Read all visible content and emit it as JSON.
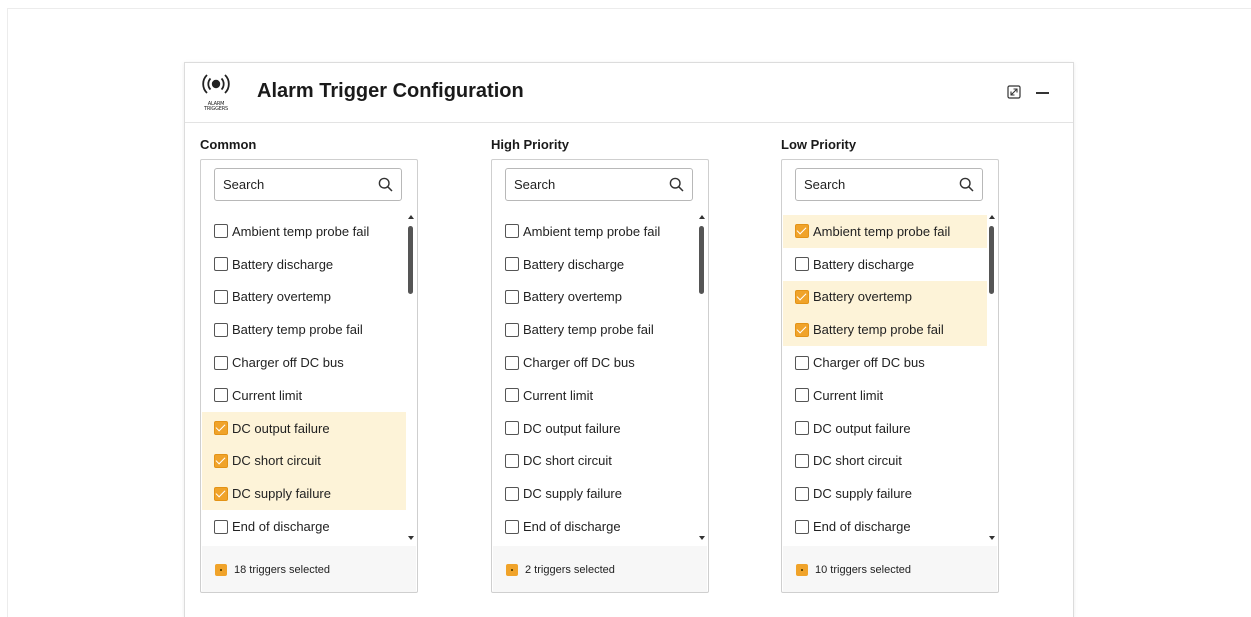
{
  "window": {
    "title": "Alarm Trigger Configuration",
    "logo_text_line1": "ALARM",
    "logo_text_line2": "TRIGGERS"
  },
  "colors": {
    "accent": "#f0a32a",
    "highlight": "#fdf3d8"
  },
  "columns": [
    {
      "heading": "Common",
      "search_placeholder": "Search",
      "items": [
        {
          "label": "Ambient temp probe fail",
          "checked": false
        },
        {
          "label": "Battery discharge",
          "checked": false
        },
        {
          "label": "Battery overtemp",
          "checked": false
        },
        {
          "label": "Battery temp probe fail",
          "checked": false
        },
        {
          "label": "Charger off DC bus",
          "checked": false
        },
        {
          "label": "Current limit",
          "checked": false
        },
        {
          "label": "DC output failure",
          "checked": true
        },
        {
          "label": "DC short circuit",
          "checked": true
        },
        {
          "label": "DC supply failure",
          "checked": true
        },
        {
          "label": "End of discharge",
          "checked": false
        }
      ],
      "footer": "18 triggers selected"
    },
    {
      "heading": "High Priority",
      "search_placeholder": "Search",
      "items": [
        {
          "label": "Ambient temp probe fail",
          "checked": false
        },
        {
          "label": "Battery discharge",
          "checked": false
        },
        {
          "label": "Battery overtemp",
          "checked": false
        },
        {
          "label": "Battery temp probe fail",
          "checked": false
        },
        {
          "label": "Charger off DC bus",
          "checked": false
        },
        {
          "label": "Current limit",
          "checked": false
        },
        {
          "label": "DC output failure",
          "checked": false
        },
        {
          "label": "DC short circuit",
          "checked": false
        },
        {
          "label": "DC supply failure",
          "checked": false
        },
        {
          "label": "End of discharge",
          "checked": false
        }
      ],
      "footer": "2 triggers selected"
    },
    {
      "heading": "Low Priority",
      "search_placeholder": "Search",
      "items": [
        {
          "label": "Ambient temp probe fail",
          "checked": true
        },
        {
          "label": "Battery discharge",
          "checked": false
        },
        {
          "label": "Battery overtemp",
          "checked": true
        },
        {
          "label": "Battery temp probe fail",
          "checked": true
        },
        {
          "label": "Charger off DC bus",
          "checked": false
        },
        {
          "label": "Current limit",
          "checked": false
        },
        {
          "label": "DC output failure",
          "checked": false
        },
        {
          "label": "DC short circuit",
          "checked": false
        },
        {
          "label": "DC supply failure",
          "checked": false
        },
        {
          "label": "End of discharge",
          "checked": false
        }
      ],
      "footer": "10 triggers selected"
    }
  ]
}
